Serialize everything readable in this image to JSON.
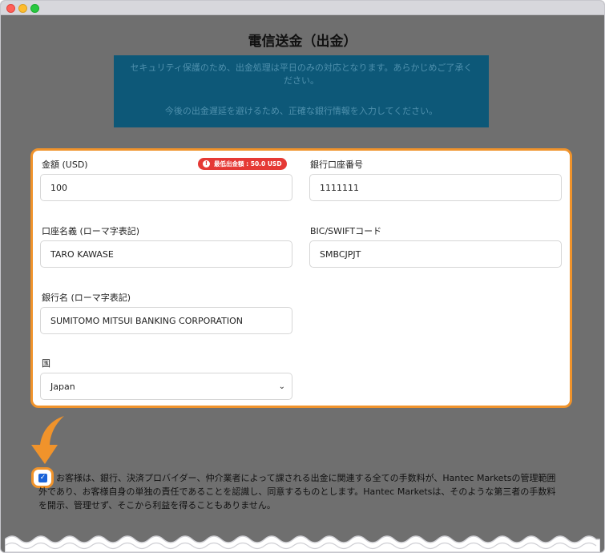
{
  "page": {
    "title": "電信送金（出金）",
    "notice_line1": "セキュリティ保護のため、出金処理は平日のみの対応となります。あらかじめご了承ください。",
    "notice_line2": "今後の出金遅延を避けるため、正確な銀行情報を入力してください。"
  },
  "form": {
    "amount_label": "金額 (USD)",
    "min_badge": "最低出金額 : 50.0 USD",
    "amount_value": "100",
    "account_number_label": "銀行口座番号",
    "account_number_value": "1111111",
    "account_name_label": "口座名義 (ローマ字表記)",
    "account_name_value": "TARO KAWASE",
    "swift_label": "BIC/SWIFTコード",
    "swift_value": "SMBCJPJT",
    "bank_name_label": "銀行名 (ローマ字表記)",
    "bank_name_value": "SUMITOMO MITSUI BANKING CORPORATION",
    "country_label": "国",
    "country_value": "Japan"
  },
  "consent": {
    "checked": true,
    "text": "お客様は、銀行、決済プロバイダー、仲介業者によって課される出金に関連する全ての手数料が、Hantec Marketsの管理範囲外であり、お客様自身の単独の責任であることを認識し、同意するものとします。Hantec Marketsは、そのような第三者の手数料を開示、管理せず、そこから利益を得ることもありません。"
  },
  "colors": {
    "highlight": "#f0932b",
    "notice_bg": "#0d5878",
    "badge": "#e53935",
    "checkbox": "#1a63d8"
  }
}
